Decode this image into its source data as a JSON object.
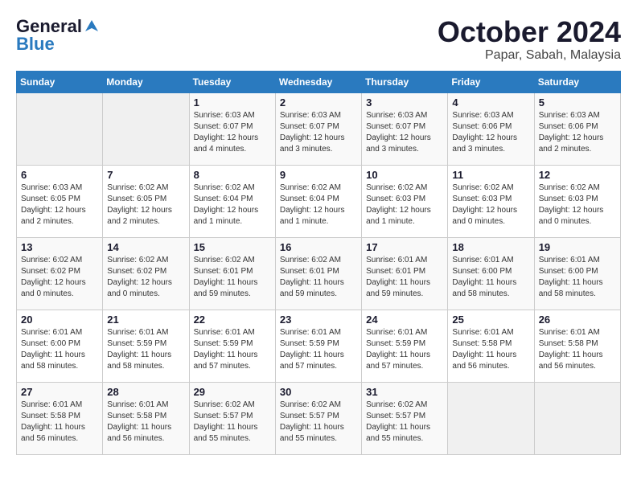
{
  "header": {
    "logo_general": "General",
    "logo_blue": "Blue",
    "month_title": "October 2024",
    "location": "Papar, Sabah, Malaysia"
  },
  "days_of_week": [
    "Sunday",
    "Monday",
    "Tuesday",
    "Wednesday",
    "Thursday",
    "Friday",
    "Saturday"
  ],
  "weeks": [
    [
      {
        "day": "",
        "info": ""
      },
      {
        "day": "",
        "info": ""
      },
      {
        "day": "1",
        "info": "Sunrise: 6:03 AM\nSunset: 6:07 PM\nDaylight: 12 hours and 4 minutes."
      },
      {
        "day": "2",
        "info": "Sunrise: 6:03 AM\nSunset: 6:07 PM\nDaylight: 12 hours and 3 minutes."
      },
      {
        "day": "3",
        "info": "Sunrise: 6:03 AM\nSunset: 6:07 PM\nDaylight: 12 hours and 3 minutes."
      },
      {
        "day": "4",
        "info": "Sunrise: 6:03 AM\nSunset: 6:06 PM\nDaylight: 12 hours and 3 minutes."
      },
      {
        "day": "5",
        "info": "Sunrise: 6:03 AM\nSunset: 6:06 PM\nDaylight: 12 hours and 2 minutes."
      }
    ],
    [
      {
        "day": "6",
        "info": "Sunrise: 6:03 AM\nSunset: 6:05 PM\nDaylight: 12 hours and 2 minutes."
      },
      {
        "day": "7",
        "info": "Sunrise: 6:02 AM\nSunset: 6:05 PM\nDaylight: 12 hours and 2 minutes."
      },
      {
        "day": "8",
        "info": "Sunrise: 6:02 AM\nSunset: 6:04 PM\nDaylight: 12 hours and 1 minute."
      },
      {
        "day": "9",
        "info": "Sunrise: 6:02 AM\nSunset: 6:04 PM\nDaylight: 12 hours and 1 minute."
      },
      {
        "day": "10",
        "info": "Sunrise: 6:02 AM\nSunset: 6:03 PM\nDaylight: 12 hours and 1 minute."
      },
      {
        "day": "11",
        "info": "Sunrise: 6:02 AM\nSunset: 6:03 PM\nDaylight: 12 hours and 0 minutes."
      },
      {
        "day": "12",
        "info": "Sunrise: 6:02 AM\nSunset: 6:03 PM\nDaylight: 12 hours and 0 minutes."
      }
    ],
    [
      {
        "day": "13",
        "info": "Sunrise: 6:02 AM\nSunset: 6:02 PM\nDaylight: 12 hours and 0 minutes."
      },
      {
        "day": "14",
        "info": "Sunrise: 6:02 AM\nSunset: 6:02 PM\nDaylight: 12 hours and 0 minutes."
      },
      {
        "day": "15",
        "info": "Sunrise: 6:02 AM\nSunset: 6:01 PM\nDaylight: 11 hours and 59 minutes."
      },
      {
        "day": "16",
        "info": "Sunrise: 6:02 AM\nSunset: 6:01 PM\nDaylight: 11 hours and 59 minutes."
      },
      {
        "day": "17",
        "info": "Sunrise: 6:01 AM\nSunset: 6:01 PM\nDaylight: 11 hours and 59 minutes."
      },
      {
        "day": "18",
        "info": "Sunrise: 6:01 AM\nSunset: 6:00 PM\nDaylight: 11 hours and 58 minutes."
      },
      {
        "day": "19",
        "info": "Sunrise: 6:01 AM\nSunset: 6:00 PM\nDaylight: 11 hours and 58 minutes."
      }
    ],
    [
      {
        "day": "20",
        "info": "Sunrise: 6:01 AM\nSunset: 6:00 PM\nDaylight: 11 hours and 58 minutes."
      },
      {
        "day": "21",
        "info": "Sunrise: 6:01 AM\nSunset: 5:59 PM\nDaylight: 11 hours and 58 minutes."
      },
      {
        "day": "22",
        "info": "Sunrise: 6:01 AM\nSunset: 5:59 PM\nDaylight: 11 hours and 57 minutes."
      },
      {
        "day": "23",
        "info": "Sunrise: 6:01 AM\nSunset: 5:59 PM\nDaylight: 11 hours and 57 minutes."
      },
      {
        "day": "24",
        "info": "Sunrise: 6:01 AM\nSunset: 5:59 PM\nDaylight: 11 hours and 57 minutes."
      },
      {
        "day": "25",
        "info": "Sunrise: 6:01 AM\nSunset: 5:58 PM\nDaylight: 11 hours and 56 minutes."
      },
      {
        "day": "26",
        "info": "Sunrise: 6:01 AM\nSunset: 5:58 PM\nDaylight: 11 hours and 56 minutes."
      }
    ],
    [
      {
        "day": "27",
        "info": "Sunrise: 6:01 AM\nSunset: 5:58 PM\nDaylight: 11 hours and 56 minutes."
      },
      {
        "day": "28",
        "info": "Sunrise: 6:01 AM\nSunset: 5:58 PM\nDaylight: 11 hours and 56 minutes."
      },
      {
        "day": "29",
        "info": "Sunrise: 6:02 AM\nSunset: 5:57 PM\nDaylight: 11 hours and 55 minutes."
      },
      {
        "day": "30",
        "info": "Sunrise: 6:02 AM\nSunset: 5:57 PM\nDaylight: 11 hours and 55 minutes."
      },
      {
        "day": "31",
        "info": "Sunrise: 6:02 AM\nSunset: 5:57 PM\nDaylight: 11 hours and 55 minutes."
      },
      {
        "day": "",
        "info": ""
      },
      {
        "day": "",
        "info": ""
      }
    ]
  ]
}
